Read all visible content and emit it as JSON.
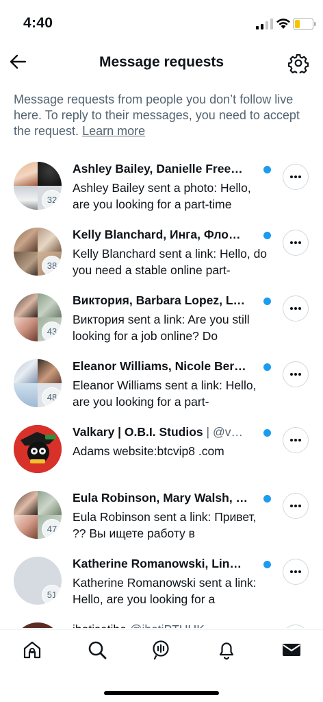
{
  "status_bar": {
    "time": "4:40"
  },
  "header": {
    "title": "Message requests"
  },
  "info": {
    "text": "Message requests from people you don’t follow live here. To reply to their messages, you need to accept the request.",
    "learn_more": "Learn more"
  },
  "requests": [
    {
      "name": "Ashley Bailey, Danielle Free…",
      "handle": "",
      "preview": "Ashley Bailey sent a photo: Hello, are you looking for a part-time",
      "count": "32",
      "unread": true
    },
    {
      "name": "Kelly Blanchard, Инга, Фло…",
      "handle": "",
      "preview": "Kelly Blanchard sent a link: Hello, do you need a stable online part-",
      "count": "38",
      "unread": true
    },
    {
      "name": "Виктория, Barbara Lopez, L…",
      "handle": "",
      "preview": "Виктория sent a link: Are you still looking for a job online?  Do",
      "count": "43",
      "unread": true
    },
    {
      "name": "Eleanor Williams, Nicole Ber…",
      "handle": "",
      "preview": "Eleanor Williams sent a link: Hello, are you looking for a part-",
      "count": "48",
      "unread": true
    },
    {
      "name": "Valkary | O.B.I. Studios",
      "handle": "| @v…",
      "preview": "Adams website:btcvip8 .com",
      "count": "",
      "unread": true
    },
    {
      "name": "Eula Robinson, Mary Walsh, …",
      "handle": "",
      "preview": "Eula Robinson sent a link: Привет, ?? Вы ищете работу в",
      "count": "47",
      "unread": true
    },
    {
      "name": "Katherine Romanowski, Lin…",
      "handle": "",
      "preview": "Katherine Romanowski sent a link: Hello, are you looking for a",
      "count": "51",
      "unread": true
    },
    {
      "name": "ibotisetibe",
      "handle": "@ibotiPTUUK",
      "preview": "",
      "count": "",
      "unread": false
    }
  ],
  "colors": {
    "accent": "#1d9bf0",
    "text": "#0f1419",
    "secondary": "#536471",
    "border": "#cfd9de"
  },
  "nav": {
    "icons": [
      "home-icon",
      "search-icon",
      "spaces-icon",
      "notifications-icon",
      "messages-icon"
    ]
  }
}
